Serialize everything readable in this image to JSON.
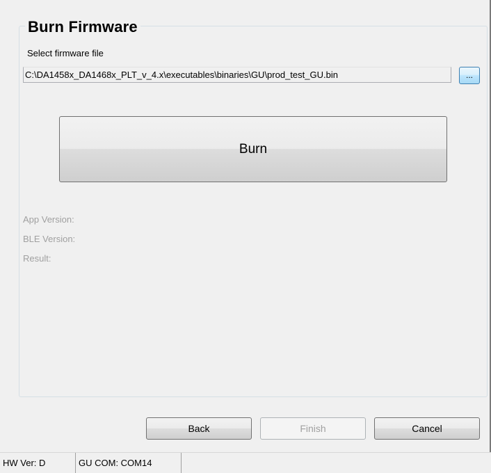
{
  "group": {
    "title": "Burn Firmware"
  },
  "firmware": {
    "label": "Select firmware file",
    "path": "C:\\DA1458x_DA1468x_PLT_v_4.x\\executables\\binaries\\GU\\prod_test_GU.bin",
    "browse_label": "..."
  },
  "burn": {
    "label": "Burn"
  },
  "info": {
    "app_version_label": "App Version:",
    "ble_version_label": "BLE Version:",
    "result_label": "Result:"
  },
  "buttons": {
    "back": "Back",
    "finish": "Finish",
    "cancel": "Cancel"
  },
  "status": {
    "hw_ver": "HW Ver:  D",
    "gu_com": "GU COM:  COM14"
  }
}
